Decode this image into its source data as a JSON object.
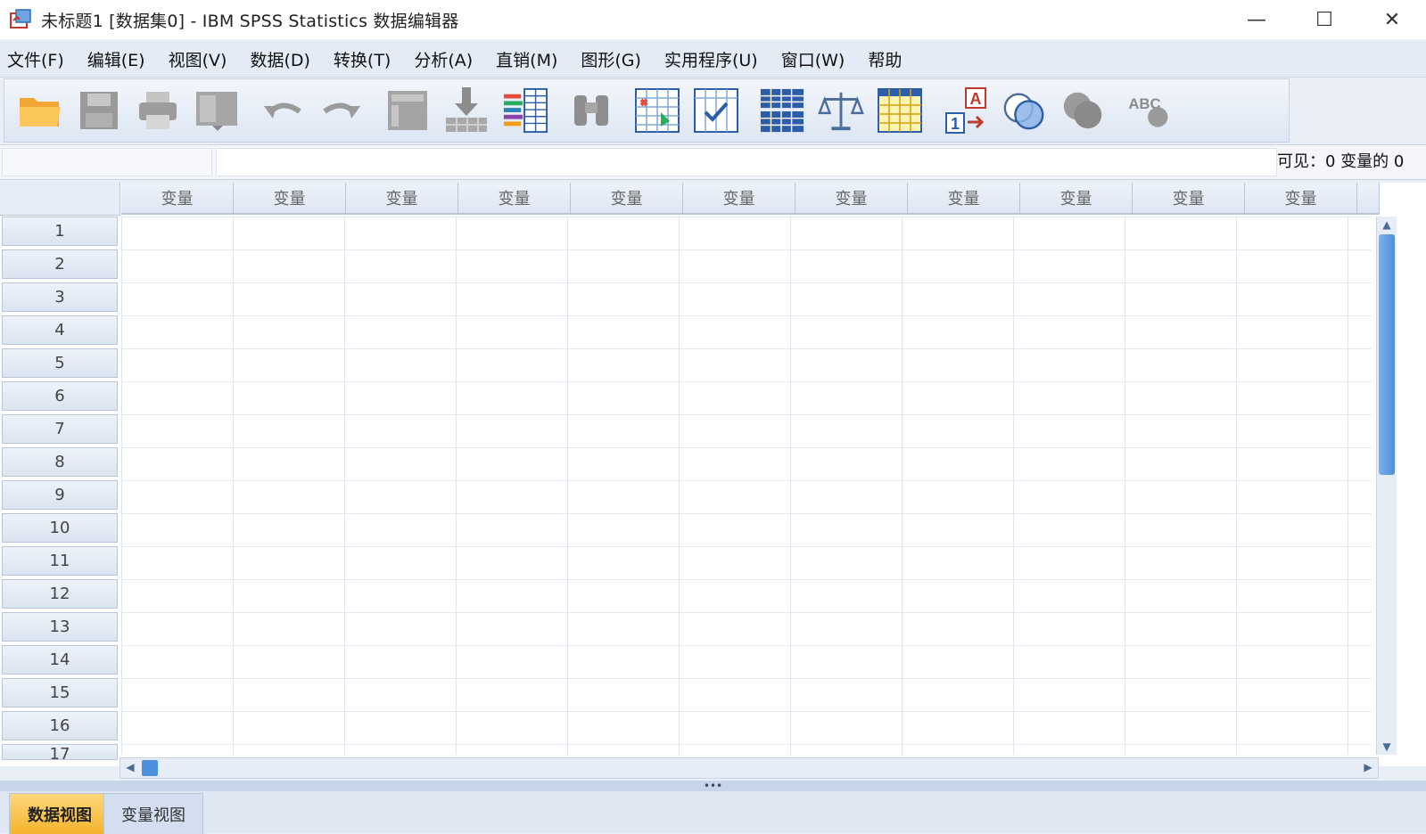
{
  "window": {
    "title": "未标题1 [数据集0] - IBM SPSS Statistics 数据编辑器",
    "controls": {
      "minimize": "—",
      "maximize": "☐",
      "close": "✕"
    }
  },
  "menu": [
    "文件(F)",
    "编辑(E)",
    "视图(V)",
    "数据(D)",
    "转换(T)",
    "分析(A)",
    "直销(M)",
    "图形(G)",
    "实用程序(U)",
    "窗口(W)",
    "帮助"
  ],
  "toolbar": {
    "icons": [
      "open-folder-icon",
      "save-icon",
      "print-icon",
      "dialog-recall-icon",
      "undo-icon",
      "redo-icon",
      "goto-case-icon",
      "goto-variable-icon",
      "variables-icon",
      "find-icon",
      "insert-cases-icon",
      "insert-variable-icon",
      "split-file-icon",
      "weight-cases-icon",
      "select-cases-icon",
      "value-labels-icon",
      "use-sets-icon",
      "show-all-variables-icon",
      "spell-check-icon"
    ],
    "value_labels_glyph_a": "A",
    "value_labels_glyph_1": "1",
    "spell_glyph": "ABC"
  },
  "editor": {
    "visible_label": "可见：",
    "visible_value": "0 变量的 0"
  },
  "grid": {
    "column_header": "变量",
    "column_count": 11,
    "rows": [
      "1",
      "2",
      "3",
      "4",
      "5",
      "6",
      "7",
      "8",
      "9",
      "10",
      "11",
      "12",
      "13",
      "14",
      "15",
      "16",
      "17"
    ]
  },
  "tabs": {
    "data_view": "数据视图",
    "variable_view": "变量视图"
  }
}
